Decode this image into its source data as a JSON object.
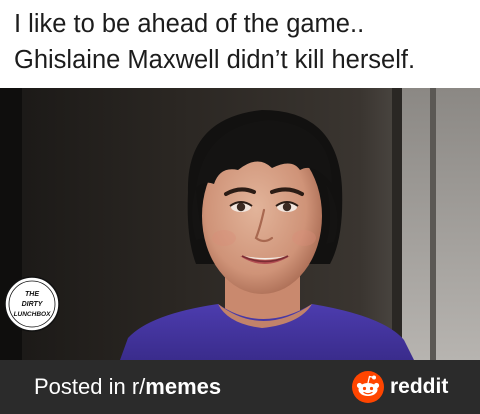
{
  "caption": {
    "line1": "I like to be ahead of the game..",
    "line2": "Ghislaine Maxwell didn’t kill herself."
  },
  "photo": {
    "subject": "woman-portrait-photo"
  },
  "watermark": {
    "line1": "THE",
    "line2": "DIRTY",
    "line3": "LUNCHBOX"
  },
  "footer": {
    "prefix": "Posted in r/",
    "subreddit": "memes",
    "brand": "reddit",
    "brand_icon": "reddit-alien-icon"
  },
  "colors": {
    "footer_bg": "#2b2b2b",
    "reddit_orange": "#ff4500",
    "shirt_purple": "#4a3aa8"
  }
}
